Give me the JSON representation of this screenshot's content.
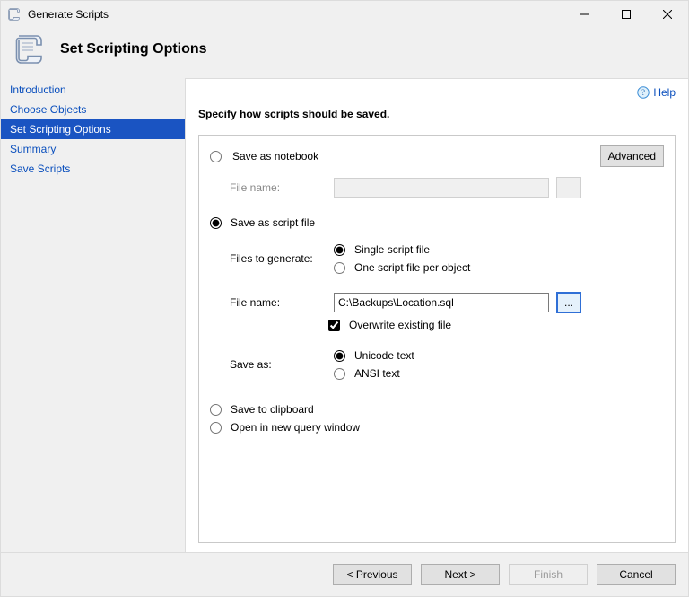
{
  "window": {
    "title": "Generate Scripts"
  },
  "page": {
    "title": "Set Scripting Options"
  },
  "help": {
    "label": "Help"
  },
  "nav": {
    "items": [
      {
        "label": "Introduction"
      },
      {
        "label": "Choose Objects"
      },
      {
        "label": "Set Scripting Options"
      },
      {
        "label": "Summary"
      },
      {
        "label": "Save Scripts"
      }
    ],
    "selected_index": 2
  },
  "main": {
    "instruction": "Specify how scripts should be saved.",
    "advanced_label": "Advanced",
    "options": {
      "save_mode": "file",
      "notebook": {
        "label": "Save as notebook",
        "file_name_label": "File name:",
        "file_name_value": ""
      },
      "file": {
        "label": "Save as script file",
        "files_to_generate_label": "Files to generate:",
        "single_label": "Single script file",
        "per_object_label": "One script file per object",
        "files_mode": "single",
        "file_name_label": "File name:",
        "file_name_value": "C:\\Backups\\Location.sql",
        "browse_label": "...",
        "overwrite_label": "Overwrite existing file",
        "overwrite_checked": true,
        "save_as_label": "Save as:",
        "unicode_label": "Unicode text",
        "ansi_label": "ANSI text",
        "encoding": "unicode"
      },
      "clipboard": {
        "label": "Save to clipboard"
      },
      "new_window": {
        "label": "Open in new query window"
      }
    }
  },
  "footer": {
    "previous": "< Previous",
    "next": "Next >",
    "finish": "Finish",
    "cancel": "Cancel"
  }
}
